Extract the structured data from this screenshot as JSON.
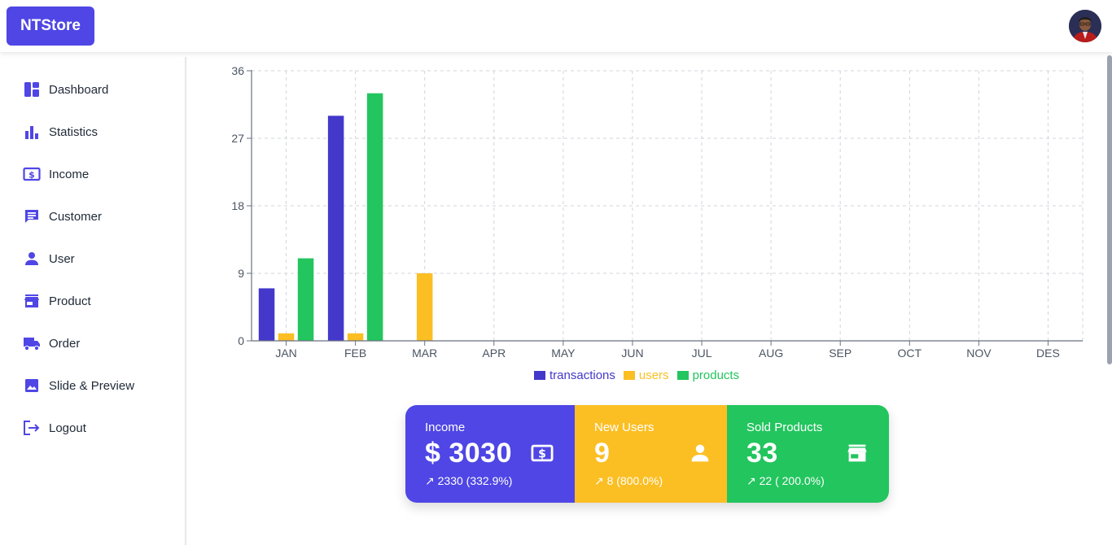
{
  "brand": {
    "name": "NTStore"
  },
  "sidebar": {
    "items": [
      {
        "label": "Dashboard",
        "icon": "dashboard-icon"
      },
      {
        "label": "Statistics",
        "icon": "bar-chart-icon"
      },
      {
        "label": "Income",
        "icon": "money-icon"
      },
      {
        "label": "Customer",
        "icon": "chat-icon"
      },
      {
        "label": "User",
        "icon": "person-icon"
      },
      {
        "label": "Product",
        "icon": "store-icon"
      },
      {
        "label": "Order",
        "icon": "truck-icon"
      },
      {
        "label": "Slide & Preview",
        "icon": "image-icon"
      },
      {
        "label": "Logout",
        "icon": "logout-icon"
      }
    ]
  },
  "colors": {
    "accent": "#4f46e5",
    "transactions": "#4338ca",
    "users": "#fbbf24",
    "products": "#22c55e"
  },
  "chart_data": {
    "type": "bar",
    "categories": [
      "JAN",
      "FEB",
      "MAR",
      "APR",
      "MAY",
      "JUN",
      "JUL",
      "AUG",
      "SEP",
      "OCT",
      "NOV",
      "DES"
    ],
    "series": [
      {
        "name": "transactions",
        "values": [
          7,
          30,
          0,
          0,
          0,
          0,
          0,
          0,
          0,
          0,
          0,
          0
        ]
      },
      {
        "name": "users",
        "values": [
          1,
          1,
          9,
          0,
          0,
          0,
          0,
          0,
          0,
          0,
          0,
          0
        ]
      },
      {
        "name": "products",
        "values": [
          11,
          33,
          0,
          0,
          0,
          0,
          0,
          0,
          0,
          0,
          0,
          0
        ]
      }
    ],
    "yticks": [
      0,
      9,
      18,
      27,
      36
    ],
    "ylim": [
      0,
      36
    ],
    "grid": true,
    "legend": "bottom-center"
  },
  "cards": [
    {
      "title": "Income",
      "value": "$ 3030",
      "sub": "↗ 2330 (332.9%)",
      "icon": "money-icon",
      "color": "#4f46e5"
    },
    {
      "title": "New Users",
      "value": "9",
      "sub": "↗ 8 (800.0%)",
      "icon": "person-icon",
      "color": "#fbbf24"
    },
    {
      "title": "Sold Products",
      "value": "33",
      "sub": "↗ 22 ( 200.0%)",
      "icon": "store-icon",
      "color": "#22c55e"
    }
  ]
}
